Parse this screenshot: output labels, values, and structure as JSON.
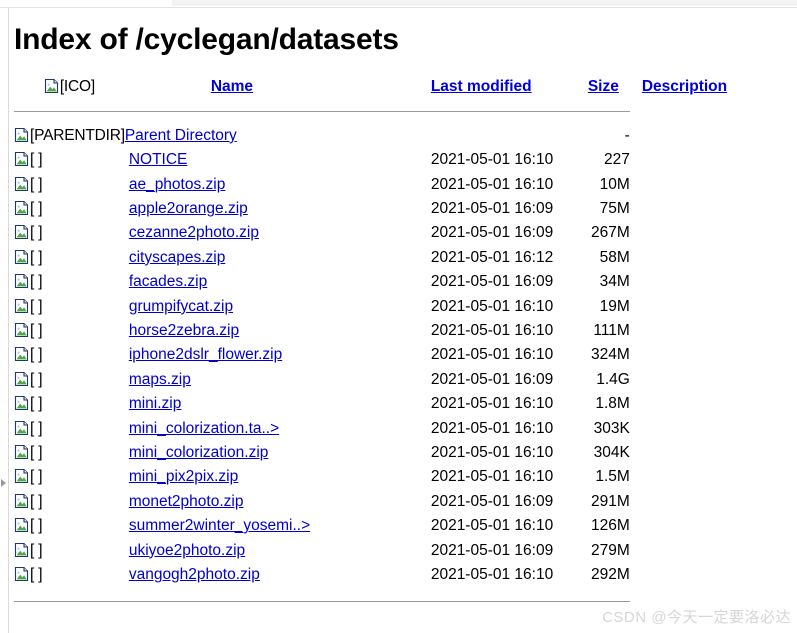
{
  "page": {
    "title": "Index of /cyclegan/datasets"
  },
  "table": {
    "headers": {
      "icon_alt": "[ICO]",
      "name": "Name",
      "last_modified": "Last modified",
      "size": "Size",
      "description": "Description"
    },
    "parent": {
      "icon_alt": "[PARENTDIR]",
      "name": "Parent Directory",
      "last_modified": "",
      "size": "-",
      "description": ""
    },
    "rows": [
      {
        "icon_alt": "[ ]",
        "name": "NOTICE",
        "last_modified": "2021-05-01 16:10",
        "size": "227",
        "description": ""
      },
      {
        "icon_alt": "[ ]",
        "name": "ae_photos.zip",
        "last_modified": "2021-05-01 16:10",
        "size": "10M",
        "description": ""
      },
      {
        "icon_alt": "[ ]",
        "name": "apple2orange.zip",
        "last_modified": "2021-05-01 16:09",
        "size": "75M",
        "description": ""
      },
      {
        "icon_alt": "[ ]",
        "name": "cezanne2photo.zip",
        "last_modified": "2021-05-01 16:09",
        "size": "267M",
        "description": ""
      },
      {
        "icon_alt": "[ ]",
        "name": "cityscapes.zip",
        "last_modified": "2021-05-01 16:12",
        "size": "58M",
        "description": ""
      },
      {
        "icon_alt": "[ ]",
        "name": "facades.zip",
        "last_modified": "2021-05-01 16:09",
        "size": "34M",
        "description": ""
      },
      {
        "icon_alt": "[ ]",
        "name": "grumpifycat.zip",
        "last_modified": "2021-05-01 16:10",
        "size": "19M",
        "description": ""
      },
      {
        "icon_alt": "[ ]",
        "name": "horse2zebra.zip",
        "last_modified": "2021-05-01 16:10",
        "size": "111M",
        "description": ""
      },
      {
        "icon_alt": "[ ]",
        "name": "iphone2dslr_flower.zip",
        "last_modified": "2021-05-01 16:10",
        "size": "324M",
        "description": ""
      },
      {
        "icon_alt": "[ ]",
        "name": "maps.zip",
        "last_modified": "2021-05-01 16:09",
        "size": "1.4G",
        "description": ""
      },
      {
        "icon_alt": "[ ]",
        "name": "mini.zip",
        "last_modified": "2021-05-01 16:10",
        "size": "1.8M",
        "description": ""
      },
      {
        "icon_alt": "[ ]",
        "name": "mini_colorization.ta..>",
        "last_modified": "2021-05-01 16:10",
        "size": "303K",
        "description": ""
      },
      {
        "icon_alt": "[ ]",
        "name": "mini_colorization.zip",
        "last_modified": "2021-05-01 16:10",
        "size": "304K",
        "description": ""
      },
      {
        "icon_alt": "[ ]",
        "name": "mini_pix2pix.zip",
        "last_modified": "2021-05-01 16:10",
        "size": "1.5M",
        "description": ""
      },
      {
        "icon_alt": "[ ]",
        "name": "monet2photo.zip",
        "last_modified": "2021-05-01 16:09",
        "size": "291M",
        "description": ""
      },
      {
        "icon_alt": "[ ]",
        "name": "summer2winter_yosemi..>",
        "last_modified": "2021-05-01 16:10",
        "size": "126M",
        "description": ""
      },
      {
        "icon_alt": "[ ]",
        "name": "ukiyoe2photo.zip",
        "last_modified": "2021-05-01 16:09",
        "size": "279M",
        "description": ""
      },
      {
        "icon_alt": "[ ]",
        "name": "vangogh2photo.zip",
        "last_modified": "2021-05-01 16:10",
        "size": "292M",
        "description": ""
      }
    ]
  },
  "watermark": {
    "text": "CSDN @今天一定要洛必达"
  },
  "colors": {
    "link": "#0000cc",
    "header_link": "#0000dd",
    "rule": "#9a9a9a",
    "text": "#000000",
    "watermark": "#d6d6d6",
    "icon_green": "#4da74d",
    "icon_outline": "#1f3864"
  }
}
